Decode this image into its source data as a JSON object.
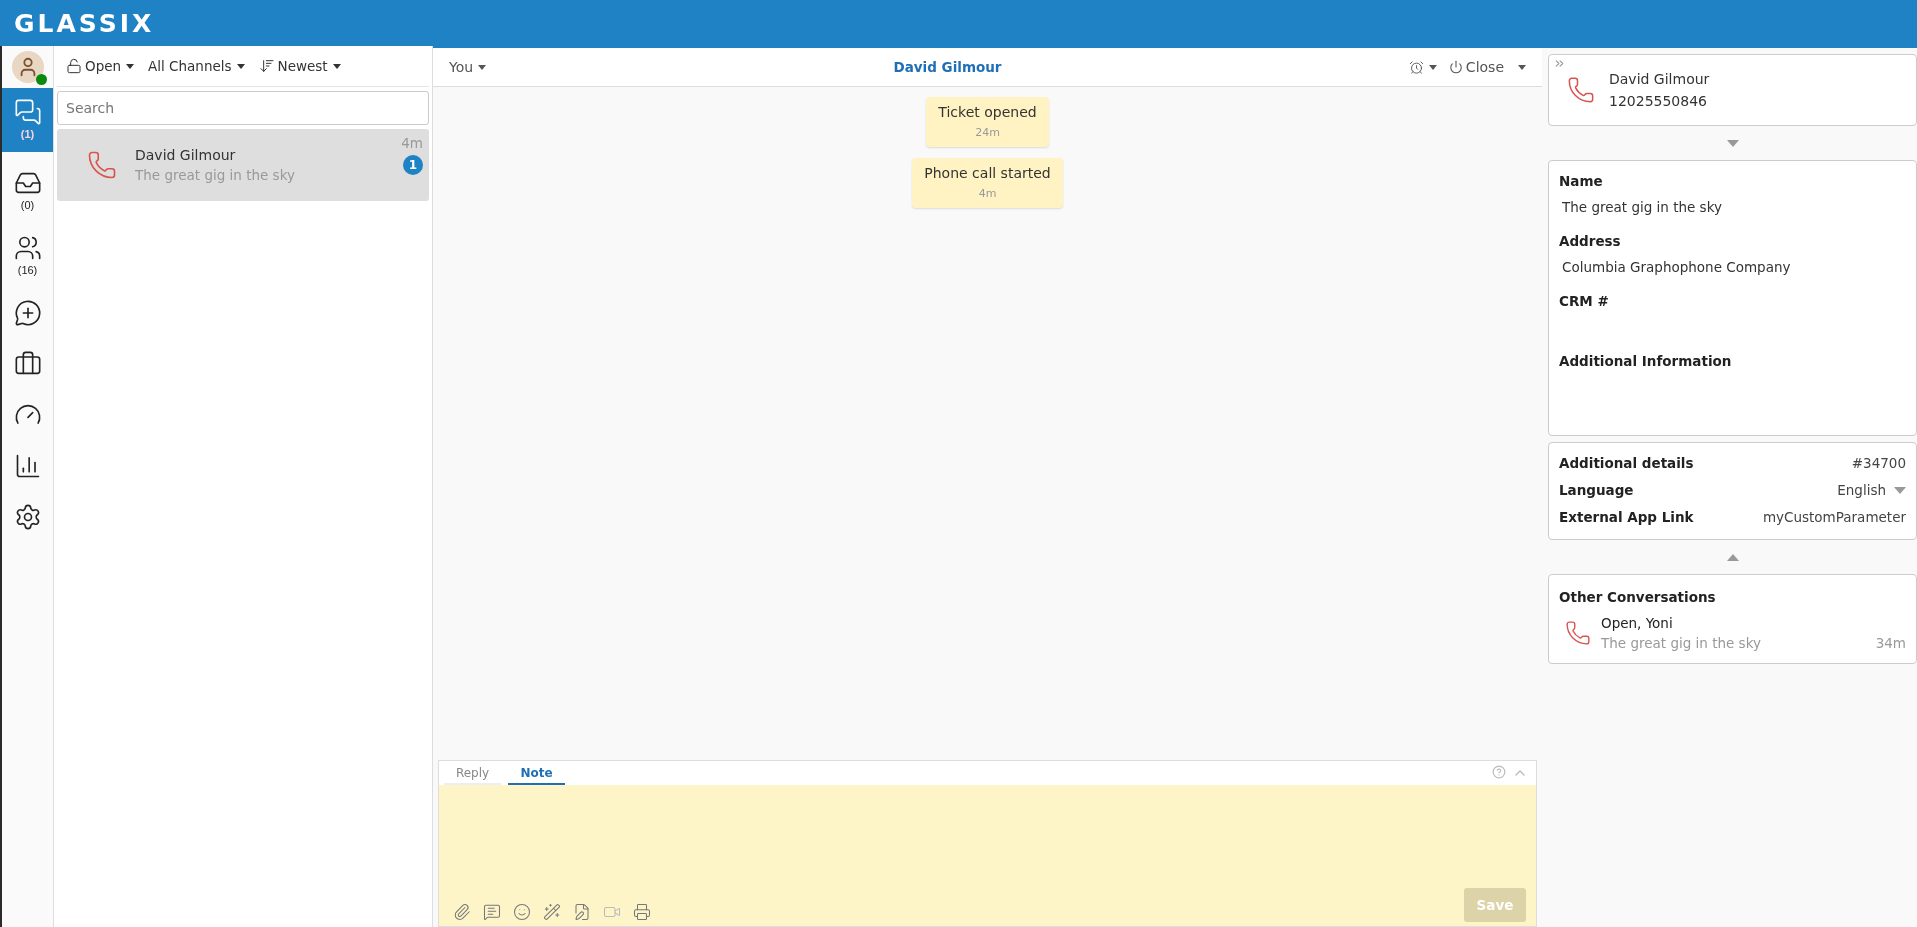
{
  "header": {
    "logo": "GLASSIX"
  },
  "nav": {
    "avatar": {
      "online": true
    },
    "items": [
      {
        "kind": "chats",
        "count": "(1)",
        "selected": true
      },
      {
        "kind": "inbox",
        "count": "(0)",
        "selected": false
      },
      {
        "kind": "team",
        "count": "(16)",
        "selected": false
      },
      {
        "kind": "new-chat",
        "selected": false
      },
      {
        "kind": "briefcase",
        "selected": false
      },
      {
        "kind": "dashboard",
        "selected": false
      },
      {
        "kind": "reports",
        "selected": false
      },
      {
        "kind": "settings",
        "selected": false
      }
    ]
  },
  "list": {
    "filters": [
      {
        "kind": "status",
        "label": "Open"
      },
      {
        "kind": "channel",
        "label": "All Channels"
      },
      {
        "kind": "sort",
        "label": "Newest"
      }
    ],
    "search": {
      "placeholder": "Search"
    },
    "conversations": [
      {
        "name": "David Gilmour",
        "preview": "The great gig in the sky",
        "time": "4m",
        "unread": "1",
        "selected": true
      }
    ]
  },
  "chat": {
    "assignee": "You",
    "title": "David Gilmour",
    "close": "Close",
    "events": [
      {
        "text": "Ticket opened",
        "time": "24m"
      },
      {
        "text": "Phone call started",
        "time": "4m"
      }
    ],
    "composer": {
      "tabs": [
        {
          "label": "Reply",
          "selected": false
        },
        {
          "label": "Note",
          "selected": true
        }
      ],
      "tools": [
        {
          "kind": "attach"
        },
        {
          "kind": "canned"
        },
        {
          "kind": "emoji"
        },
        {
          "kind": "magic"
        },
        {
          "kind": "signature"
        },
        {
          "kind": "video"
        },
        {
          "kind": "print"
        }
      ],
      "save": {
        "label": "Save",
        "disabled": true
      }
    }
  },
  "contact": {
    "name": "David Gilmour",
    "phone": "12025550846",
    "fields": [
      {
        "label": "Name",
        "value": "The great gig in the sky"
      },
      {
        "label": "Address",
        "value": "Columbia Graphophone Company"
      },
      {
        "label": "CRM #"
      },
      {
        "label": "Additional Information"
      }
    ],
    "details": [
      {
        "kind": "text",
        "label": "Additional details",
        "value": "#34700"
      },
      {
        "kind": "select",
        "label": "Language",
        "value": "English"
      },
      {
        "kind": "link",
        "label": "External App Link",
        "value": "myCustomParameter"
      }
    ],
    "other": {
      "title": "Other Conversations",
      "items": [
        {
          "title": "Open, Yoni",
          "preview": "The great gig in the sky",
          "time": "34m"
        }
      ]
    }
  }
}
